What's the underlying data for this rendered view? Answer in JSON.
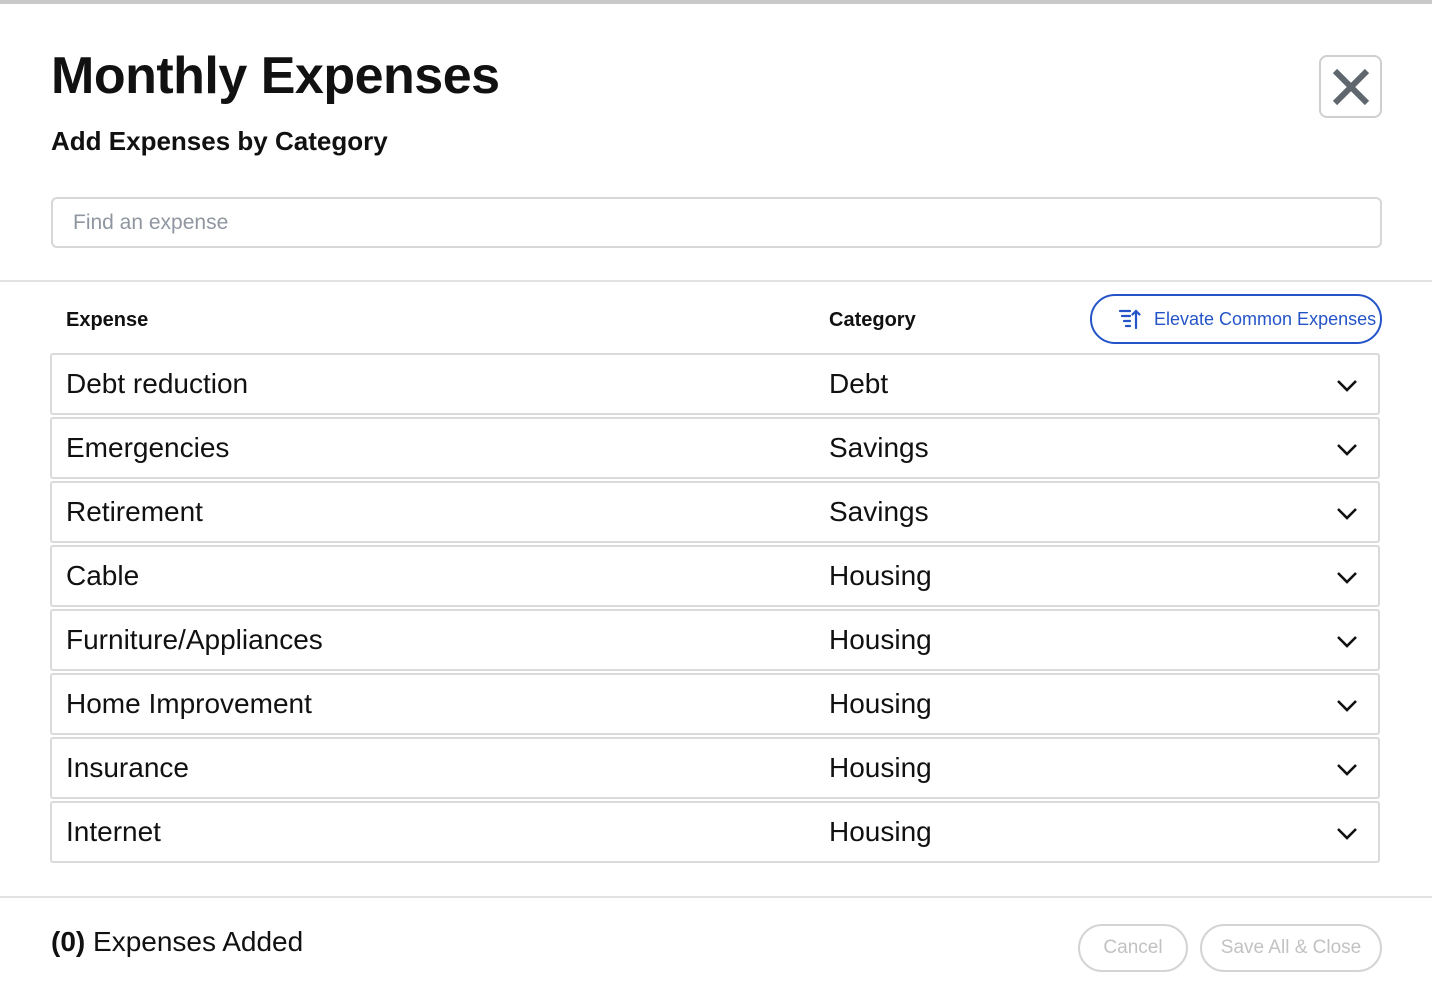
{
  "dialog": {
    "title": "Monthly Expenses",
    "subtitle": "Add Expenses by Category",
    "close_icon": "close-icon"
  },
  "search": {
    "placeholder": "Find an expense",
    "value": ""
  },
  "table": {
    "headers": {
      "expense": "Expense",
      "category": "Category"
    },
    "elevate_button": {
      "label": "Elevate Common Expenses",
      "icon": "sort-up-icon"
    },
    "rows": [
      {
        "expense": "Debt reduction",
        "category": "Debt"
      },
      {
        "expense": "Emergencies",
        "category": "Savings"
      },
      {
        "expense": "Retirement",
        "category": "Savings"
      },
      {
        "expense": "Cable",
        "category": "Housing"
      },
      {
        "expense": "Furniture/Appliances",
        "category": "Housing"
      },
      {
        "expense": "Home Improvement",
        "category": "Housing"
      },
      {
        "expense": "Insurance",
        "category": "Housing"
      },
      {
        "expense": "Internet",
        "category": "Housing"
      }
    ]
  },
  "footer": {
    "count": "(0)",
    "count_label": "Expenses Added",
    "cancel_label": "Cancel",
    "save_label": "Save All & Close"
  },
  "colors": {
    "accent": "#2454c7",
    "disabled_text": "#c2c2c2",
    "border": "#dadada"
  }
}
